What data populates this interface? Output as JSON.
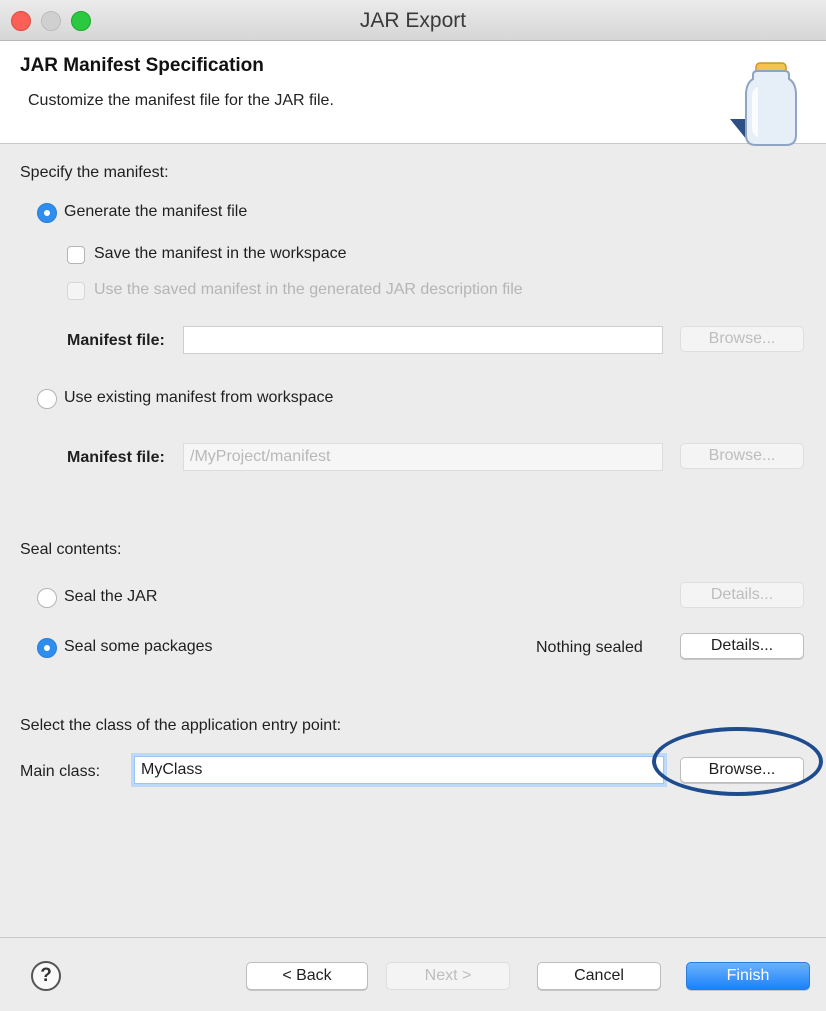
{
  "window": {
    "title": "JAR Export"
  },
  "header": {
    "title": "JAR Manifest Specification",
    "description": "Customize the manifest file for the JAR file."
  },
  "manifest": {
    "section_label": "Specify the manifest:",
    "generate_label": "Generate the manifest file",
    "generate_selected": true,
    "save_in_workspace_label": "Save the manifest in the workspace",
    "save_in_workspace_checked": false,
    "use_saved_label": "Use the saved manifest in the generated JAR description file",
    "use_saved_checked": false,
    "manifest_file_label": "Manifest file:",
    "manifest_file_value": "",
    "browse_label": "Browse...",
    "use_existing_label": "Use existing manifest from workspace",
    "use_existing_selected": false,
    "existing_manifest_file_label": "Manifest file:",
    "existing_manifest_file_value": "/MyProject/manifest",
    "existing_browse_label": "Browse..."
  },
  "seal": {
    "section_label": "Seal contents:",
    "seal_jar_label": "Seal the JAR",
    "seal_jar_selected": false,
    "seal_jar_details_label": "Details...",
    "seal_some_label": "Seal some packages",
    "seal_some_selected": true,
    "status": "Nothing sealed",
    "seal_some_details_label": "Details..."
  },
  "entry_point": {
    "section_label": "Select the class of the application entry point:",
    "main_class_label": "Main class:",
    "main_class_value": "MyClass",
    "browse_label": "Browse..."
  },
  "footer": {
    "help_glyph": "?",
    "back_label": "< Back",
    "next_label": "Next >",
    "cancel_label": "Cancel",
    "finish_label": "Finish"
  },
  "colors": {
    "accent": "#2f8ded",
    "annotation": "#1e4c8f"
  }
}
